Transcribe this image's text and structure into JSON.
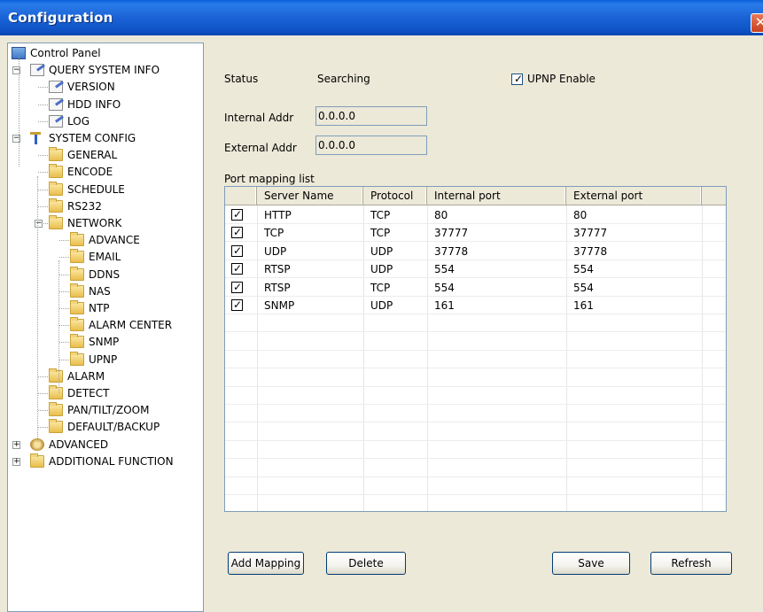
{
  "window": {
    "title": "Configuration",
    "close_glyph": "✕"
  },
  "tree": [
    {
      "label": "Control Panel",
      "icon": "computer-icon"
    },
    {
      "label": "QUERY SYSTEM INFO",
      "icon": "document-edit-icon",
      "expander": "−"
    },
    {
      "label": "VERSION",
      "icon": "document-edit-icon"
    },
    {
      "label": "HDD INFO",
      "icon": "document-edit-icon"
    },
    {
      "label": "LOG",
      "icon": "document-edit-icon"
    },
    {
      "label": "SYSTEM CONFIG",
      "icon": "tools-icon",
      "expander": "−"
    },
    {
      "label": "GENERAL",
      "icon": "folder-icon"
    },
    {
      "label": "ENCODE",
      "icon": "folder-icon"
    },
    {
      "label": "SCHEDULE",
      "icon": "folder-icon"
    },
    {
      "label": "RS232",
      "icon": "folder-icon"
    },
    {
      "label": "NETWORK",
      "icon": "folder-icon",
      "expander": "−"
    },
    {
      "label": "ADVANCE",
      "icon": "folder-icon"
    },
    {
      "label": "EMAIL",
      "icon": "folder-icon"
    },
    {
      "label": "DDNS",
      "icon": "folder-icon"
    },
    {
      "label": "NAS",
      "icon": "folder-icon"
    },
    {
      "label": "NTP",
      "icon": "folder-icon"
    },
    {
      "label": "ALARM CENTER",
      "icon": "folder-icon"
    },
    {
      "label": "SNMP",
      "icon": "folder-icon"
    },
    {
      "label": "UPNP",
      "icon": "open-folder-icon"
    },
    {
      "label": "ALARM",
      "icon": "folder-icon"
    },
    {
      "label": "DETECT",
      "icon": "folder-icon"
    },
    {
      "label": "PAN/TILT/ZOOM",
      "icon": "folder-icon"
    },
    {
      "label": "DEFAULT/BACKUP",
      "icon": "folder-icon"
    },
    {
      "label": "ADVANCED",
      "icon": "gear-icon",
      "expander": "+"
    },
    {
      "label": "ADDITIONAL FUNCTION",
      "icon": "folder-icon",
      "expander": "+"
    }
  ],
  "upnp": {
    "status_label": "Status",
    "status_value": "Searching",
    "enable_label": "UPNP Enable",
    "enable_checked": true,
    "enable_check_glyph": "✓",
    "internal_addr_label": "Internal Addr",
    "internal_addr_value": "0.0.0.0",
    "external_addr_label": "External Addr",
    "external_addr_value": "0.0.0.0",
    "list_label": "Port mapping list"
  },
  "table": {
    "headers": [
      "Server Name",
      "Protocol",
      "Internal port",
      "External port"
    ],
    "rows": [
      [
        "HTTP",
        "TCP",
        "80",
        "80"
      ],
      [
        "TCP",
        "TCP",
        "37777",
        "37777"
      ],
      [
        "UDP",
        "UDP",
        "37778",
        "37778"
      ],
      [
        "RTSP",
        "UDP",
        "554",
        "554"
      ],
      [
        "RTSP",
        "TCP",
        "554",
        "554"
      ],
      [
        "SNMP",
        "UDP",
        "161",
        "161"
      ]
    ],
    "rows_checked": [
      true,
      true,
      true,
      true,
      true,
      true
    ]
  },
  "buttons": {
    "add_mapping": "Add Mapping",
    "delete": "Delete",
    "save": "Save",
    "refresh": "Refresh"
  }
}
